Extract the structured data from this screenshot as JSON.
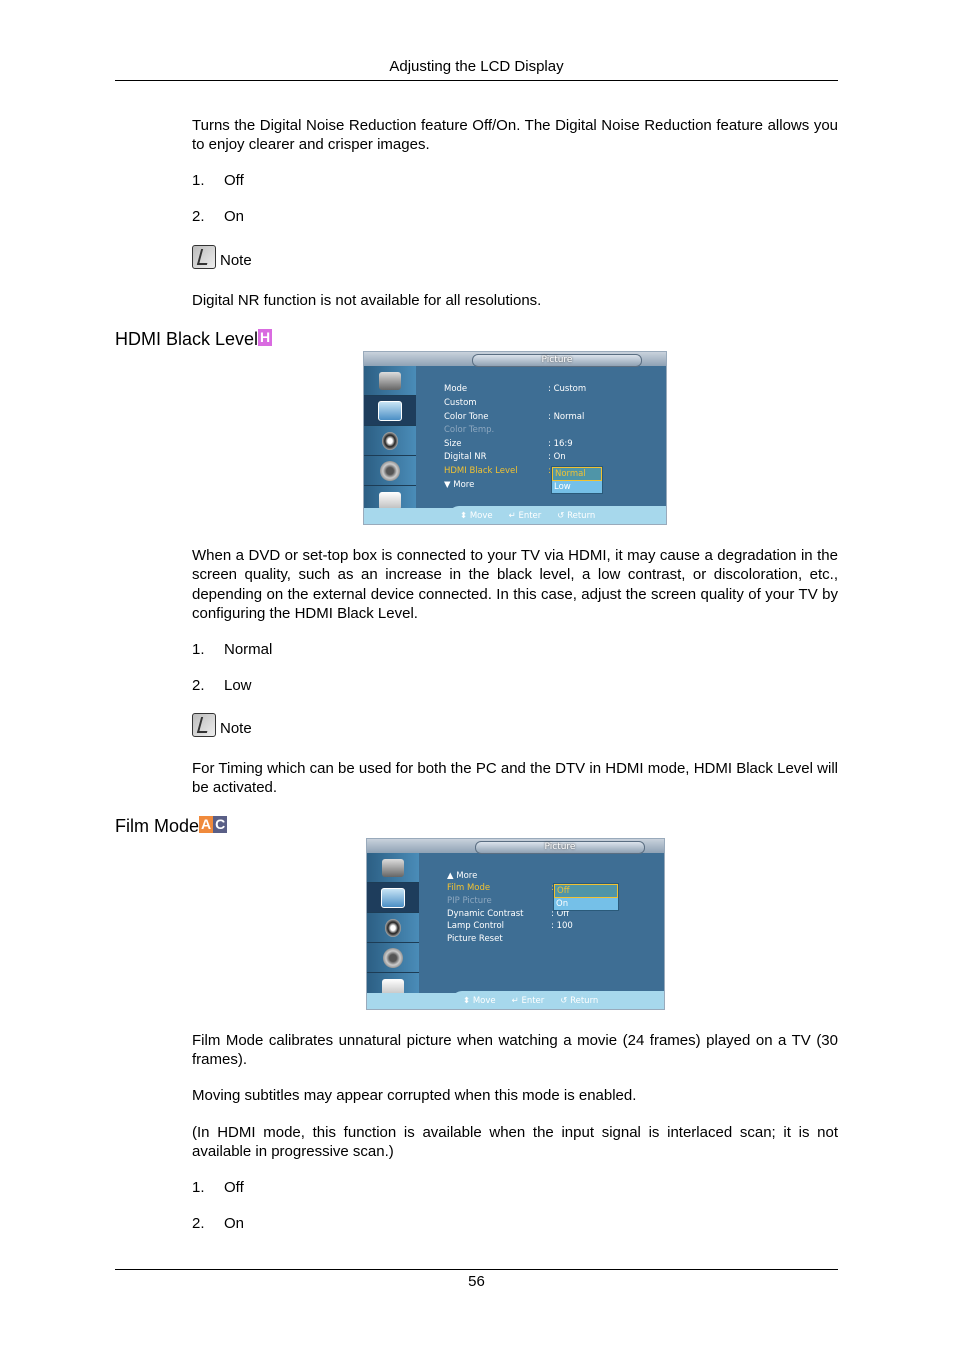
{
  "header": {
    "title": "Adjusting the LCD Display"
  },
  "footer": {
    "page_number": "56"
  },
  "digital_nr": {
    "intro_pre": "Turns the Digital Noise Reduction feature ",
    "intro_bold": "Off/On",
    "intro_post": ". The Digital Noise Reduction feature allows you to enjoy clearer and crisper images.",
    "options": [
      {
        "num": "1.",
        "label": "Off"
      },
      {
        "num": "2.",
        "label": "On"
      }
    ],
    "note_label": "Note",
    "note_bold": "Digital NR",
    "note_text": " function is not available for all resolutions."
  },
  "hdmi_black_level": {
    "heading": "HDMI Black Level",
    "badge": "H",
    "badge_color": "#d96be0",
    "osd": {
      "title": "Picture",
      "rows": [
        {
          "label": "Mode",
          "value": ": Custom",
          "state": "normal"
        },
        {
          "label": "Custom",
          "value": "",
          "state": "normal"
        },
        {
          "label": "Color Tone",
          "value": ": Normal",
          "state": "normal"
        },
        {
          "label": "Color Temp.",
          "value": "",
          "state": "dim"
        },
        {
          "label": "Size",
          "value": ": 16:9",
          "state": "normal"
        },
        {
          "label": "Digital NR",
          "value": ": On",
          "state": "normal"
        },
        {
          "label": "HDMI Black Level",
          "value": ":",
          "state": "selected"
        },
        {
          "label": "▼ More",
          "value": "",
          "state": "normal"
        }
      ],
      "dropdown": [
        "Normal",
        "Low"
      ],
      "dropdown_selected": "Normal",
      "hints": [
        "⬍ Move",
        "↵ Enter",
        "↺ Return"
      ]
    },
    "body_pre": "When a DVD or set-top box is connected to your TV via HDMI, it may cause a degradation in the screen quality, such as an increase in the black level, a low contrast, or discoloration, etc., depending on the external device connected. In this case, adjust the screen quality of your TV by configuring the ",
    "body_bold": "HDMI Black Level",
    "body_post": ".",
    "options": [
      {
        "num": "1.",
        "label": "Normal"
      },
      {
        "num": "2.",
        "label": "Low"
      }
    ],
    "note_label": "Note",
    "note_pre": "For Timing which can be used for both the PC and the DTV in ",
    "note_bold1": "HDMI",
    "note_mid": " mode, ",
    "note_bold2": "HDMI Black Level",
    "note_post": " will be activated."
  },
  "film_mode": {
    "heading": "Film Mode",
    "badge_a": "A",
    "badge_a_color": "#f08a3c",
    "badge_c": "C",
    "badge_c_color": "#5a5f86",
    "osd": {
      "title": "Picture",
      "rows": [
        {
          "label": "▲  More",
          "value": "",
          "state": "normal"
        },
        {
          "label": "Film Mode",
          "value": ":",
          "state": "selected"
        },
        {
          "label": "PIP Picture",
          "value": "",
          "state": "dim"
        },
        {
          "label": "Dynamic Contrast",
          "value": ": Off",
          "state": "normal"
        },
        {
          "label": "Lamp Control",
          "value": ": 100",
          "state": "normal"
        },
        {
          "label": "Picture Reset",
          "value": "",
          "state": "normal"
        }
      ],
      "dropdown": [
        "Off",
        "On"
      ],
      "dropdown_selected": "Off",
      "hints": [
        "⬍ Move",
        "↵ Enter",
        "↺ Return"
      ]
    },
    "p1_bold": "Film Mode",
    "p1_text": " calibrates unnatural picture when watching a movie (24 frames) played on a TV (30 frames).",
    "p2": "Moving subtitles may appear corrupted when this mode is enabled.",
    "p3_pre": "(In ",
    "p3_bold": "HDMI",
    "p3_post": " mode, this function is available when the input signal is interlaced scan; it is not available in progressive scan.)",
    "options": [
      {
        "num": "1.",
        "label": "Off"
      },
      {
        "num": "2.",
        "label": "On"
      }
    ]
  }
}
